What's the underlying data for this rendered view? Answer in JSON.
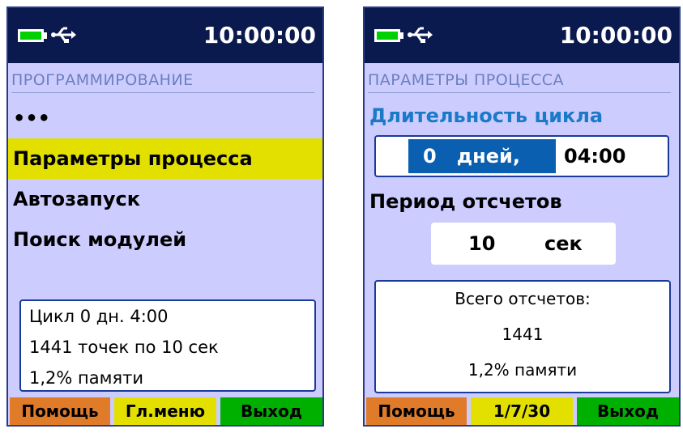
{
  "colors": {
    "screen_bg": "#ccccff",
    "header_bg": "#0b1a4e",
    "highlight_yellow": "#e3e000",
    "button_orange": "#e07b2a",
    "button_green": "#00b000",
    "selection_blue": "#0a5fb0",
    "subtitle_blue": "#1a7ac8",
    "section_title": "#6b7fbf"
  },
  "left": {
    "status": {
      "battery_icon": "battery-full-icon",
      "usb_icon": "usb-icon",
      "time": "10:00:00"
    },
    "section_title": "ПРОГРАММИРОВАНИЕ",
    "menu": [
      {
        "label": "•••",
        "selected": false
      },
      {
        "label": "Параметры процесса",
        "selected": true
      },
      {
        "label": "Автозапуск",
        "selected": false
      },
      {
        "label": "Поиск модулей",
        "selected": false
      }
    ],
    "info": [
      "Цикл 0 дн. 4:00",
      "1441 точек по 10 сек",
      "1,2% памяти"
    ],
    "buttons": {
      "help": "Помощь",
      "main_menu": "Гл.меню",
      "exit": "Выход"
    }
  },
  "right": {
    "status": {
      "battery_icon": "battery-full-icon",
      "usb_icon": "usb-icon",
      "time": "10:00:00"
    },
    "section_title": "ПАРАМЕТРЫ ПРОЦЕССА",
    "cycle_title": "Длительность цикла",
    "cycle_days": "0   дней,",
    "cycle_time": "04:00",
    "period_title": "Период отсчетов",
    "period_value": "10",
    "period_unit": "сек",
    "total_label": "Всего отсчетов:",
    "total_value": "1441",
    "memory": "1,2% памяти",
    "buttons": {
      "help": "Помощь",
      "page": "1/7/30",
      "exit": "Выход"
    }
  }
}
